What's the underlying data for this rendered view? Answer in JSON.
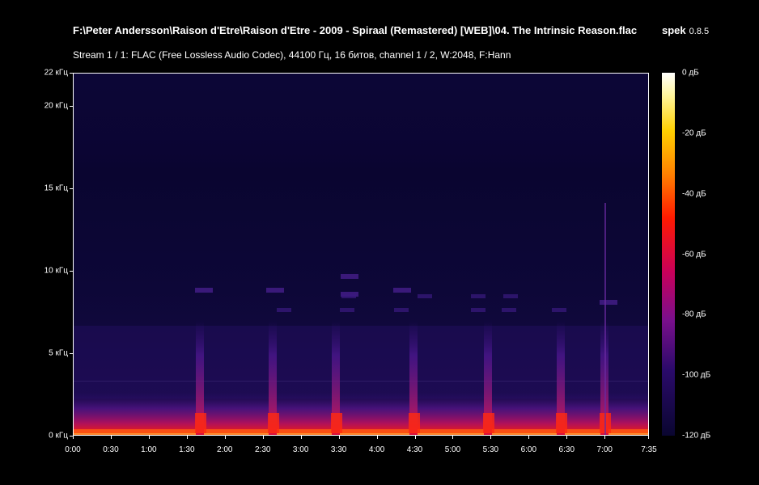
{
  "header": {
    "file_title": "F:\\Peter Andersson\\Raison d'Etre\\Raison d'Etre - 2009 - Spiraal (Remastered) [WEB]\\04. The Intrinsic Reason.flac",
    "app_name": "spek",
    "app_version": "0.8.5",
    "stream_info": "Stream 1 / 1: FLAC (Free Lossless Audio Codec), 44100 Гц, 16 битов, channel 1 / 2, W:2048, F:Hann"
  },
  "y_axis": {
    "unit_labels": [
      "22 кГц",
      "20 кГц",
      "15 кГц",
      "10 кГц",
      "5 кГц",
      "0 кГц"
    ],
    "values_khz": [
      22,
      20,
      15,
      10,
      5,
      0
    ],
    "max_khz": 22
  },
  "x_axis": {
    "labels": [
      "0:00",
      "0:30",
      "1:00",
      "1:30",
      "2:00",
      "2:30",
      "3:00",
      "3:30",
      "4:00",
      "4:30",
      "5:00",
      "5:30",
      "6:00",
      "6:30",
      "7:00",
      "7:35"
    ],
    "seconds": [
      0,
      30,
      60,
      90,
      120,
      150,
      180,
      210,
      240,
      270,
      300,
      330,
      360,
      390,
      420,
      455
    ],
    "duration_seconds": 455
  },
  "color_scale": {
    "labels": [
      "0 дБ",
      "-20 дБ",
      "-40 дБ",
      "-60 дБ",
      "-80 дБ",
      "-100 дБ",
      "-120 дБ"
    ],
    "db_values": [
      0,
      -20,
      -40,
      -60,
      -80,
      -100,
      -120
    ]
  }
}
